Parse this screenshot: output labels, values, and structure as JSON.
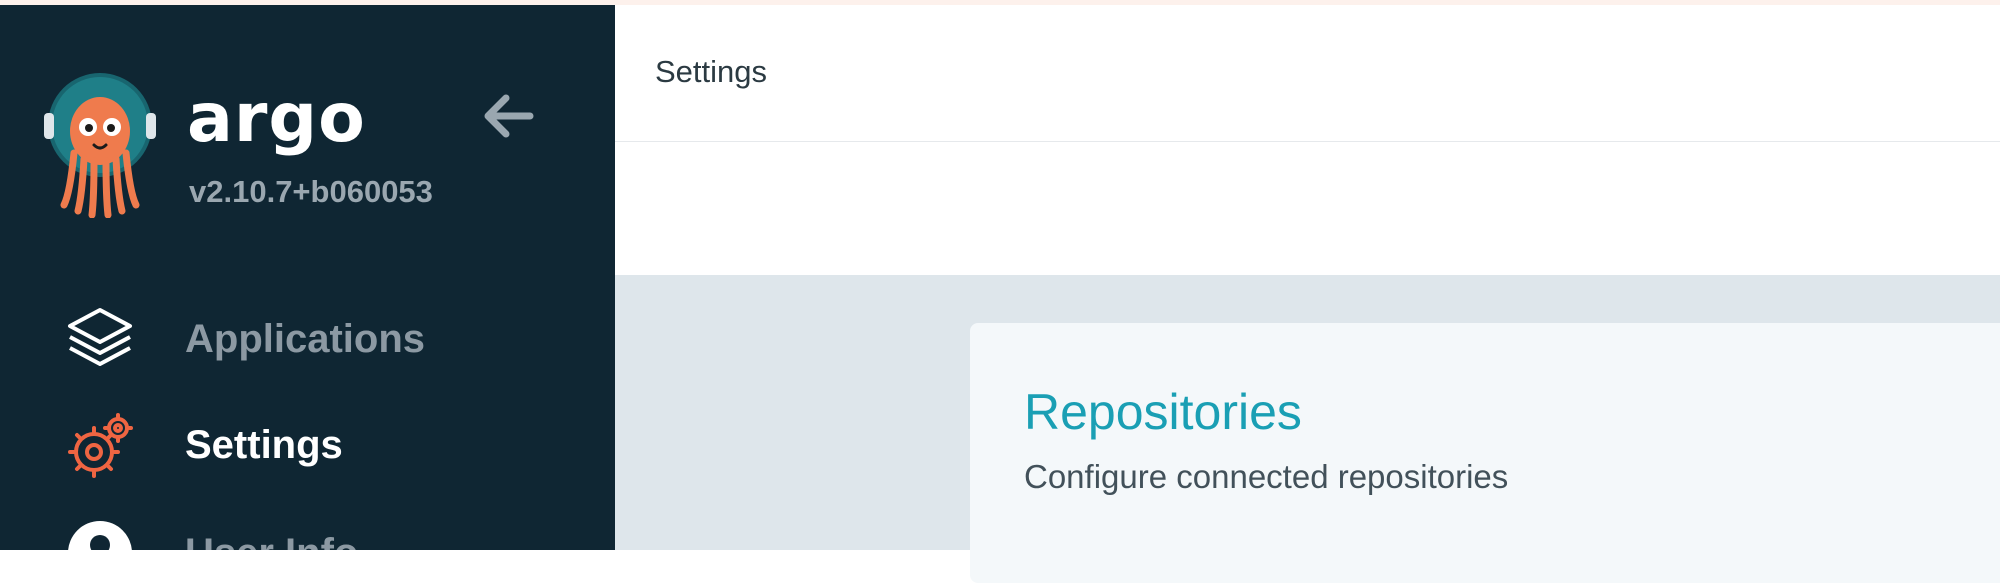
{
  "app": {
    "brand": "argo",
    "version": "v2.10.7+b060053"
  },
  "sidebar": {
    "items": [
      {
        "label": "Applications",
        "icon": "layers-icon",
        "active": false
      },
      {
        "label": "Settings",
        "icon": "gears-icon",
        "active": true
      },
      {
        "label": "User Info",
        "icon": "user-icon",
        "active": false
      }
    ]
  },
  "header": {
    "title": "Settings"
  },
  "main": {
    "cards": [
      {
        "title": "Repositories",
        "description": "Configure connected repositories"
      }
    ]
  },
  "colors": {
    "sidebar_bg": "#0f2633",
    "accent_orange": "#ef6542",
    "card_title": "#1a9fb4",
    "content_bg": "#dee6eb"
  }
}
